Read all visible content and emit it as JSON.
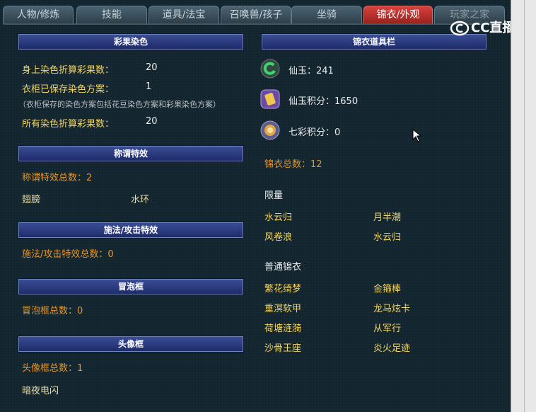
{
  "tabs": [
    "人物/修炼",
    "技能",
    "道具/法宝",
    "召唤兽/孩子",
    "坐骑",
    "锦衣/外观",
    "玩家之家"
  ],
  "active_tab": "锦衣/外观",
  "left": {
    "dye": {
      "header": "彩果染色",
      "rows": [
        {
          "label": "身上染色折算彩果数：",
          "value": "20"
        },
        {
          "label": "衣柜已保存染色方案：",
          "value": "1"
        }
      ],
      "note": "（衣柜保存的染色方案包括花豆染色方案和彩果染色方案）",
      "total": {
        "label": "所有染色折算彩果数：",
        "value": "20"
      }
    },
    "title_effect": {
      "header": "称谓特效",
      "count": "称谓特效总数：2",
      "items": [
        "翅膀",
        "水环"
      ]
    },
    "cast_effect": {
      "header": "施法/攻击特效",
      "count": "施法/攻击特效总数：0"
    },
    "bubble": {
      "header": "冒泡框",
      "count": "冒泡框总数：0"
    },
    "avatar_frame": {
      "header": "头像框",
      "count": "头像框总数：1",
      "items": [
        "暗夜电闪"
      ]
    }
  },
  "right": {
    "header": "锦衣道具栏",
    "currencies": [
      {
        "label": "仙玉：241",
        "icon": "jade-icon"
      },
      {
        "label": "仙玉积分：1650",
        "icon": "jade-points-icon"
      },
      {
        "label": "七彩积分：0",
        "icon": "rainbow-points-icon"
      }
    ],
    "total": "锦衣总数：12",
    "limited": {
      "title": "限量",
      "items": [
        "水云归",
        "月半潮",
        "风卷浪",
        "水云归"
      ]
    },
    "normal": {
      "title": "普通锦衣",
      "items": [
        "繁花绮梦",
        "金箍棒",
        "重溟软甲",
        "龙马炫卡",
        "荷塘涟漪",
        "从军行",
        "沙骨王座",
        "炎火足迹"
      ]
    }
  },
  "overlay": {
    "logo": "CC直播"
  }
}
